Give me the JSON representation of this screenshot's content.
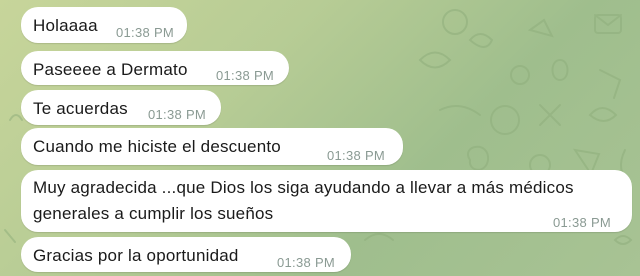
{
  "chat": {
    "messages": [
      {
        "text": "Holaaaa",
        "time": "01:38 PM"
      },
      {
        "text": "Paseeee a Dermato",
        "time": "01:38 PM"
      },
      {
        "text": "Te acuerdas",
        "time": "01:38 PM"
      },
      {
        "text": "Cuando me hiciste el descuento",
        "time": "01:38 PM"
      },
      {
        "text": "Muy agradecida ...que Dios los siga ayudando a llevar a más médicos generales a cumplir los sueños",
        "time": "01:38 PM"
      },
      {
        "text": "Gracias por la oportunidad",
        "time": "01:38 PM"
      }
    ]
  },
  "colors": {
    "bubble": "#ffffff",
    "text": "#1a1a1a",
    "time": "#8a9a93",
    "wallpaper": "#b7cc95"
  }
}
